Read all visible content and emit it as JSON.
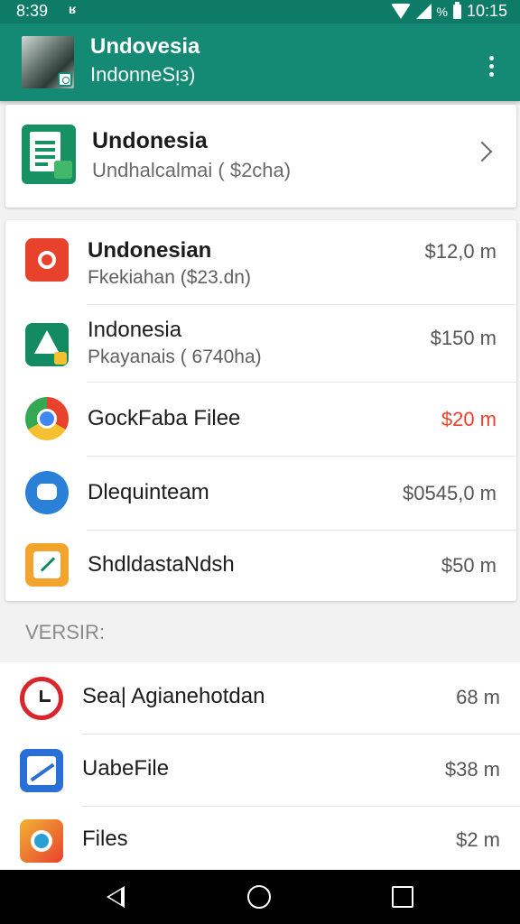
{
  "status_bar": {
    "time": "8:39",
    "notification": "ʁ",
    "battery_text": "%",
    "clock": "10:15"
  },
  "app_bar": {
    "title": "Undoᴠesia",
    "subtitle": "IndonneSᴉᴈ)"
  },
  "top_card": {
    "title": "Undonesia",
    "subtitle": "Undhalcalmai ( $2cha)"
  },
  "list1": [
    {
      "name": "Undonesian",
      "detail": "Fkekiahan ($23.dn)",
      "price": "$12,0 m",
      "price_color": "#555555",
      "icon": "gear-icon",
      "icon_color": "#e8412c"
    },
    {
      "name": "Indonesia",
      "detail": "Pkayanais ( 6740ha)",
      "price": "$150 m",
      "price_color": "#555555",
      "icon": "triangle-a-icon",
      "icon_color": "#148a62"
    },
    {
      "name": "GockFaba Filee",
      "detail": "",
      "price": "$20 m",
      "price_color": "#e8412c",
      "icon": "chrome-icon",
      "icon_color": "#4285f4"
    },
    {
      "name": "Dlequinteam",
      "detail": "",
      "price": "$0545,0 m",
      "price_color": "#555555",
      "icon": "chat-bubble-icon",
      "icon_color": "#2a7fd6"
    },
    {
      "name": "ShdldastaNdsh",
      "detail": "",
      "price": "$50 m",
      "price_color": "#555555",
      "icon": "pencil-note-icon",
      "icon_color": "#f2a42c"
    }
  ],
  "section_label": "VERSIR:",
  "list2": [
    {
      "name": "Sea| Agianehotdan",
      "price": "68 m",
      "icon": "clock-icon",
      "icon_color": "#d9262c"
    },
    {
      "name": "UabeFile",
      "price": "$38 m",
      "icon": "chart-line-icon",
      "icon_color": "#2a6fd6"
    },
    {
      "name": "Files",
      "price": "$2 m",
      "icon": "files-app-icon",
      "icon_color": "#f07a2a"
    }
  ]
}
